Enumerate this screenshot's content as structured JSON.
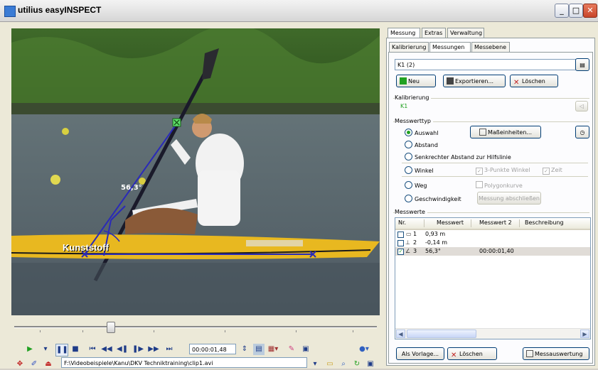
{
  "window": {
    "title": "utilius easyINSPECT",
    "buttons": [
      "_",
      "□",
      "✕"
    ]
  },
  "video": {
    "angle_label": "56,3°",
    "brand_text": "Kunststoff",
    "scrub_position": 0.26
  },
  "player": {
    "time": "00:00:01,48",
    "file_path": "F:\\Videobeispiele\\Kanu\\DKV Techniktraining\\clip1.avi",
    "buttons": [
      "play",
      "dropdown",
      "pause",
      "stop",
      "first",
      "rewind",
      "prev-frame",
      "next-frame",
      "forward",
      "last"
    ]
  },
  "tabs_top": {
    "items": [
      "Messung",
      "Extras",
      "Verwaltung"
    ],
    "active": "Messung"
  },
  "tabs_sub": {
    "items": [
      "Kalibrierung",
      "Messungen",
      "Messebene"
    ],
    "active": "Messungen"
  },
  "measurement_select": {
    "value": "K1 (2)"
  },
  "buttons": {
    "new": "Neu",
    "export": "Exportieren...",
    "delete": "Löschen"
  },
  "calibration": {
    "group_label": "Kalibrierung",
    "value": "K1"
  },
  "measure_type": {
    "group_label": "Messwerttyp",
    "options": [
      "Auswahl",
      "Abstand",
      "Senkrechter Abstand zur Hilfslinie",
      "Winkel",
      "Weg",
      "Geschwindigkeit"
    ],
    "selected": "Auswahl",
    "units_button": "Maßeinheiten...",
    "three_point_angle": "3-Punkte Winkel",
    "time_check": "Zeit",
    "polygon_curve": "Polygonkurve",
    "finish_button": "Messung abschließen"
  },
  "values": {
    "group_label": "Messwerte",
    "columns": [
      "Nr.",
      "Messwert",
      "Messwert 2",
      "Beschreibung"
    ],
    "rows": [
      {
        "nr": "1",
        "value": "0,93 m",
        "value2": "",
        "desc": "",
        "checked": false
      },
      {
        "nr": "2",
        "value": "-0,14 m",
        "value2": "",
        "desc": "",
        "checked": false
      },
      {
        "nr": "3",
        "value": "56,3°",
        "value2": "00:00:01,40",
        "desc": "",
        "checked": true
      }
    ]
  },
  "bottom_buttons": {
    "template": "Als Vorlage...",
    "delete": "Löschen",
    "evaluation": "Messauswertung"
  },
  "colors": {
    "accent": "#21a121",
    "measure_line": "#2a2ab8",
    "kayak": "#e8b820"
  }
}
